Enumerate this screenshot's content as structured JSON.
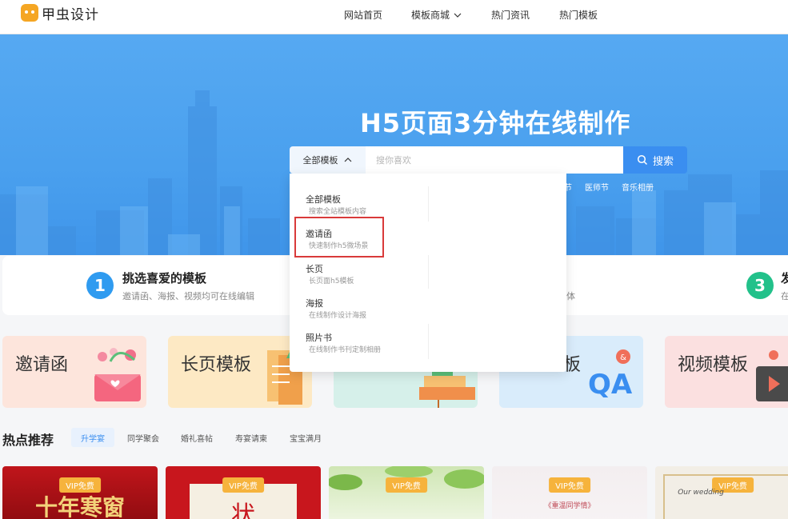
{
  "header": {
    "logo_text": "甲虫设计",
    "nav": [
      {
        "label": "网站首页"
      },
      {
        "label": "模板商城"
      },
      {
        "label": "热门资讯"
      },
      {
        "label": "热门模板"
      }
    ]
  },
  "hero": {
    "title": "H5页面3分钟在线制作",
    "hot_tags": [
      "节",
      "医师节",
      "音乐相册"
    ]
  },
  "search": {
    "category": "全部模板",
    "placeholder": "搜你喜欢",
    "button": "搜索"
  },
  "dropdown": {
    "items": [
      {
        "title": "全部模板",
        "sub": "搜索全站模板内容"
      },
      {
        "title": "邀请函",
        "sub": "快速制作h5微场景"
      },
      {
        "title": "长页",
        "sub": "长页面h5模板"
      },
      {
        "title": "海报",
        "sub": "在线制作设计海报"
      },
      {
        "title": "照片书",
        "sub": "在线制作书刊定制相册"
      }
    ]
  },
  "steps": [
    {
      "num": "1",
      "title": "挑选喜爱的模板",
      "desc": "邀请函、海报、视频均可在线编辑",
      "color": "#2f9bf0"
    },
    {
      "num": "",
      "title": "",
      "desc": "体",
      "color": ""
    },
    {
      "num": "3",
      "title": "发",
      "desc": "在",
      "color": "#22c18a"
    }
  ],
  "categories": [
    {
      "label": "邀请函",
      "bg": "#fde5dc"
    },
    {
      "label": "长页模板",
      "bg": "#fde9c4"
    },
    {
      "label": "",
      "bg": "#d6f0ea"
    },
    {
      "label": "板",
      "bg": "#d9ecfb"
    },
    {
      "label": "视频模板",
      "bg": "#fbe0e0"
    }
  ],
  "hot": {
    "title": "热点推荐",
    "tabs": [
      "升学宴",
      "同学聚会",
      "婚礼喜帖",
      "寿宴请柬",
      "宝宝满月"
    ]
  },
  "thumbs": [
    {
      "badge": "VIP免费",
      "text": "十年寒窗"
    },
    {
      "badge": "VIP免费",
      "text": "状"
    },
    {
      "badge": "VIP免费",
      "text": ""
    },
    {
      "badge": "VIP免费",
      "text": "《重温同学情》"
    },
    {
      "badge": "VIP免费",
      "text": "Our wedding"
    }
  ],
  "colors": {
    "primary": "#3a8ef0",
    "hero_bg": "#4aa0ee",
    "highlight_box": "#d93a3a",
    "vip_badge": "#f6b33c"
  }
}
